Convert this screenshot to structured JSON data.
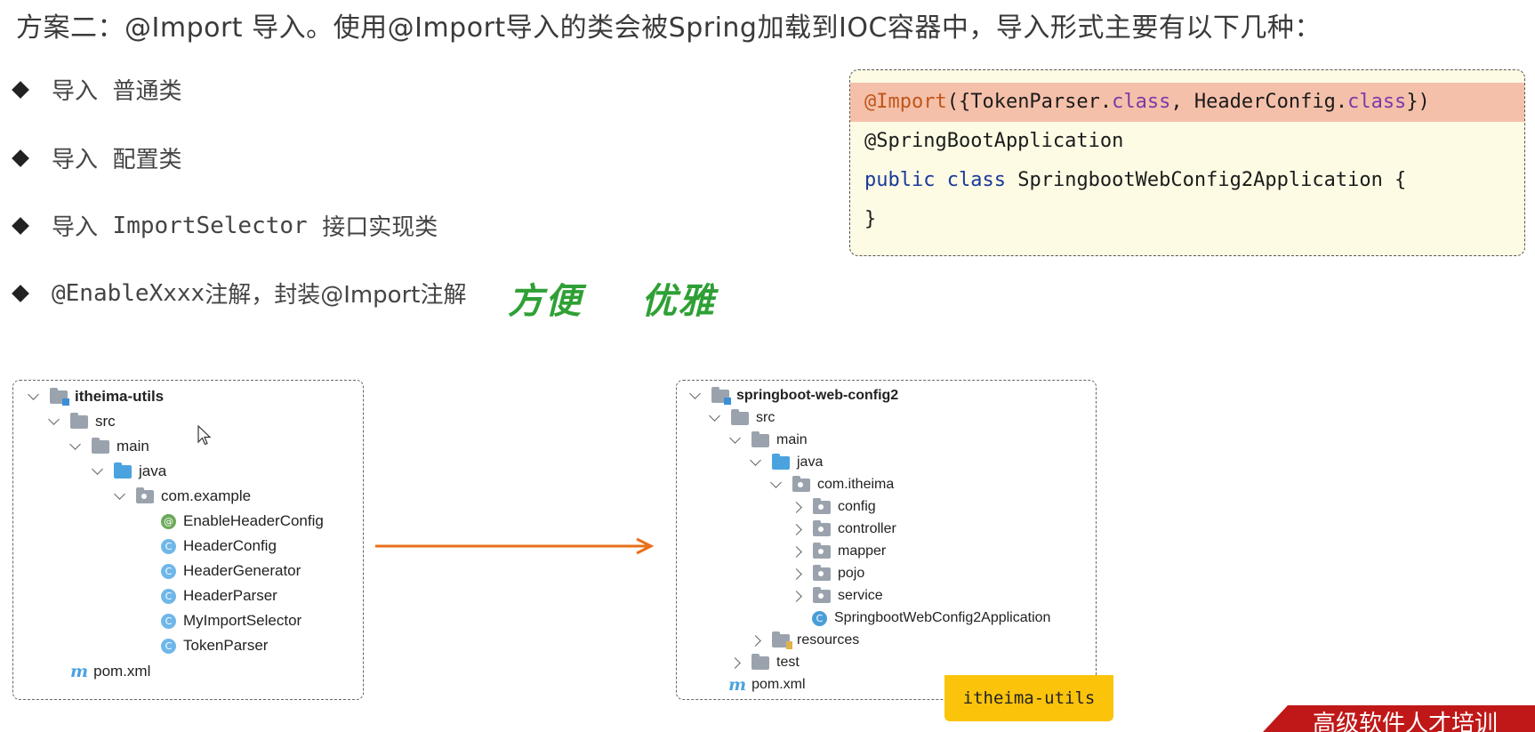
{
  "heading": "方案二：@Import 导入。使用@Import导入的类会被Spring加载到IOC容器中，导入形式主要有以下几种：",
  "bullets": [
    {
      "prefix": "导入",
      "text": "普通类"
    },
    {
      "prefix": "导入",
      "text": "配置类"
    },
    {
      "prefix": "导入",
      "mono": "ImportSelector",
      "text": "接口实现类"
    },
    {
      "mono": "@EnableXxxx",
      "text": "注解，封装@Import注解"
    }
  ],
  "callout": {
    "word1": "方便",
    "word2": "优雅",
    "color": "#2fa035"
  },
  "code": {
    "line1": {
      "ann": "@Import",
      "open": "({TokenParser.",
      "kw1": "class",
      "mid": ", HeaderConfig.",
      "kw2": "class",
      "close": "})"
    },
    "line2": "@SpringBootApplication",
    "line3": {
      "kw1": "public",
      "kw2": "class",
      "rest": " SpringbootWebConfig2Application {"
    },
    "line4": "}"
  },
  "tree_left": {
    "root": "itheima-utils",
    "src": "src",
    "main": "main",
    "java": "java",
    "package": "com.example",
    "classes": [
      {
        "icon": "@",
        "name": "EnableHeaderConfig"
      },
      {
        "icon": "C",
        "name": "HeaderConfig"
      },
      {
        "icon": "C",
        "name": "HeaderGenerator"
      },
      {
        "icon": "C",
        "name": "HeaderParser"
      },
      {
        "icon": "C",
        "name": "MyImportSelector"
      },
      {
        "icon": "C",
        "name": "TokenParser"
      }
    ],
    "pom": "pom.xml",
    "pom_icon": "m"
  },
  "tree_right": {
    "root": "springboot-web-config2",
    "src": "src",
    "main": "main",
    "java": "java",
    "package": "com.itheima",
    "subpackages": [
      "config",
      "controller",
      "mapper",
      "pojo",
      "service"
    ],
    "app_class": "SpringbootWebConfig2Application",
    "resources": "resources",
    "test": "test",
    "pom": "pom.xml",
    "pom_icon": "m"
  },
  "tag": "itheima-utils",
  "corner_text": "高级软件人才培训",
  "colors": {
    "arrow": "#e8701a",
    "highlight": "#f5c0aa",
    "code_bg": "#fdfbe4",
    "tag": "#fbc40b",
    "corner": "#c01818"
  }
}
